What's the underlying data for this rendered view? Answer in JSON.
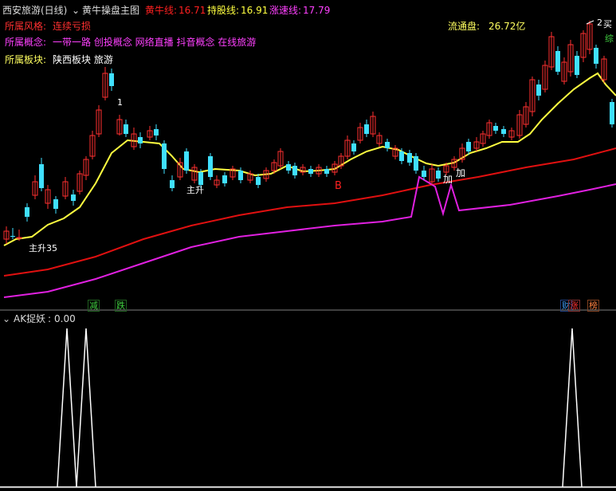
{
  "header": {
    "title": "西安旅游(日线)",
    "indicator_name": "黄牛操盘主图",
    "lines": [
      {
        "label": "黄牛线:",
        "value": "16.71",
        "color": "#ff2020"
      },
      {
        "label": "持股线:",
        "value": "16.91",
        "color": "#ffff40"
      },
      {
        "label": "涨速线:",
        "value": "17.79",
        "color": "#ff40ff"
      }
    ]
  },
  "info": {
    "style_label": "所属风格:",
    "style_value": "连续亏损",
    "concept_label": "所属概念:",
    "concept_value": "一带一路 创投概念 网络直播 抖音概念 在线旅游",
    "sector_label": "所属板块:",
    "sector_value": "陕西板块 旅游",
    "float_label": "流通盘:",
    "float_value": "26.72亿"
  },
  "annotations": {
    "main_rise": "主升35",
    "main_rise2": "主升",
    "b_label": "B",
    "add1": "加",
    "add2": "加",
    "one": "1",
    "two": "2",
    "right_buy": "买",
    "right_comp": "综"
  },
  "bottom_tags": {
    "reduce": "减",
    "fall": "跌",
    "fin": "财",
    "rise": "涨",
    "rank": "榜"
  },
  "sub_panel": {
    "title": "AK捉妖",
    "value": "0.00"
  },
  "colors": {
    "up": "#ff3030",
    "down": "#40e0ff",
    "yellow": "#ffff40",
    "red_line": "#e01010",
    "magenta": "#e020e0",
    "label_red": "#ff3030",
    "label_magenta": "#ff40ff",
    "label_yellow": "#ffff60"
  }
}
